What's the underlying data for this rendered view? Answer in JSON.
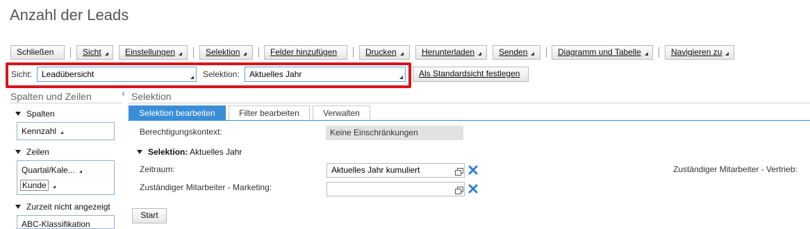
{
  "page": {
    "title": "Anzahl der Leads"
  },
  "toolbar": {
    "close": "Schließen",
    "view": "Sicht",
    "settings": "Einstellungen",
    "selection": "Selektion",
    "add_fields": "Felder hinzufügen",
    "print": "Drucken",
    "download": "Herunterladen",
    "send": "Senden",
    "chart_table": "Diagramm und Tabelle",
    "navigate": "Navigieren zu"
  },
  "viewbar": {
    "view_label": "Sicht:",
    "view_value": "Leadübersicht",
    "selection_label": "Selektion:",
    "selection_value": "Aktuelles Jahr",
    "set_default": "Als Standardsicht festlegen"
  },
  "left_panel": {
    "title": "Spalten und Zeilen",
    "columns_label": "Spalten",
    "columns_items": [
      "Kennzahl"
    ],
    "rows_label": "Zeilen",
    "rows_items": [
      "Quartal/Kale...",
      "Kunde"
    ],
    "hidden_label": "Zurzeit nicht angezeigt",
    "hidden_items": [
      "ABC-Klassifikation"
    ]
  },
  "selection_panel": {
    "title": "Selektion",
    "tabs": [
      "Selektion bearbeiten",
      "Filter bearbeiten",
      "Verwalten"
    ],
    "auth_context_label": "Berechtigungskontext:",
    "auth_context_value": "Keine Einschränkungen",
    "section_label": "Selektion:",
    "section_value": "Aktuelles Jahr",
    "period_label": "Zeitraum:",
    "period_value": "Aktuelles Jahr kumuliert",
    "marketing_label": "Zuständiger Mitarbeiter - Marketing:",
    "marketing_value": "",
    "sales_label": "Zuständiger Mitarbeiter - Vertrieb:",
    "start_button": "Start"
  },
  "colors": {
    "highlight_red": "#d7141c",
    "tab_blue": "#3a8ed8",
    "remove_blue": "#2f7fd0"
  }
}
